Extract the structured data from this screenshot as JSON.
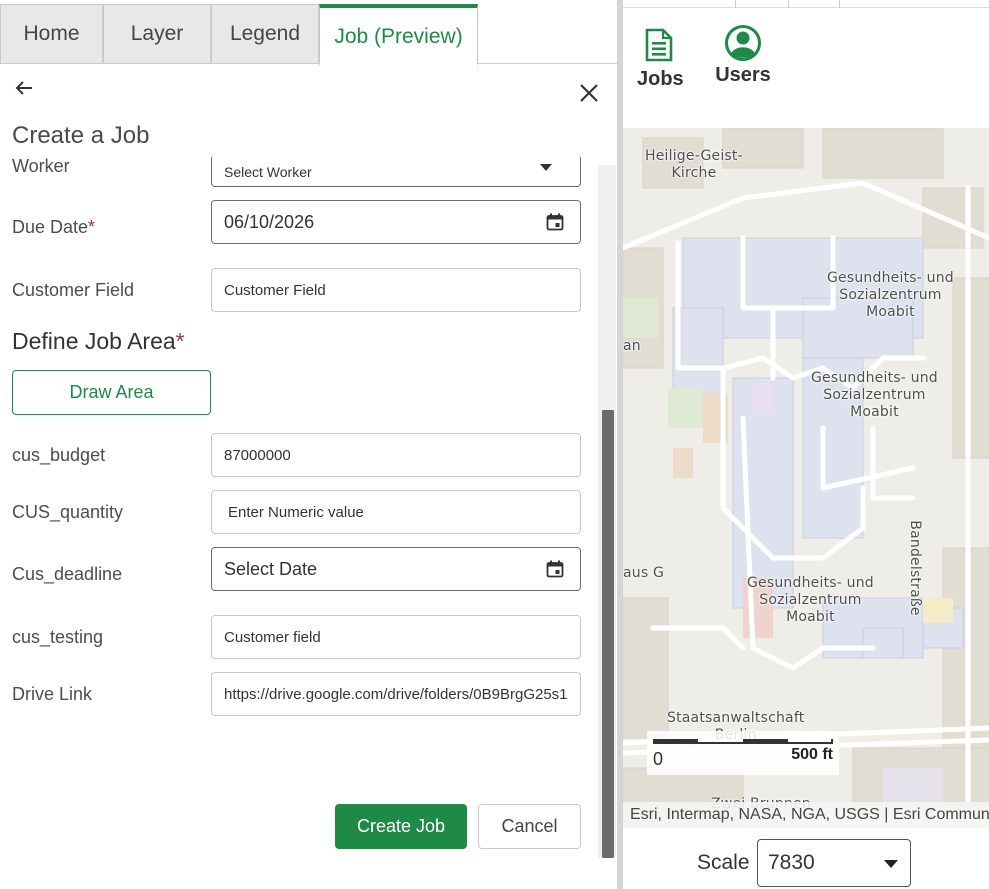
{
  "tabs": [
    "Home",
    "Layer",
    "Legend",
    "Job (Preview)"
  ],
  "panel": {
    "title": "Create a Job"
  },
  "form": {
    "worker": {
      "label": "Worker",
      "value": "Select Worker"
    },
    "due_date": {
      "label": "Due Date",
      "required": "*",
      "value": "06/10/2026"
    },
    "customer_field": {
      "label": "Customer Field",
      "placeholder": "Customer Field"
    },
    "job_area": {
      "title": "Define Job Area",
      "required": "*",
      "button": "Draw Area"
    },
    "cus_budget": {
      "label": "cus_budget",
      "value": "87000000"
    },
    "cus_quantity": {
      "label": "CUS_quantity",
      "placeholder": "Enter Numeric value"
    },
    "cus_deadline": {
      "label": "Cus_deadline",
      "placeholder": "Select Date"
    },
    "cus_testing": {
      "label": "cus_testing",
      "placeholder": "Customer field"
    },
    "drive_link": {
      "label": "Drive Link",
      "value": "https://drive.google.com/drive/folders/0B9BrgG25s1"
    }
  },
  "buttons": {
    "create": "Create Job",
    "cancel": "Cancel"
  },
  "widgets": {
    "jobs": "Jobs",
    "users": "Users"
  },
  "map": {
    "labels": {
      "heilige_geist_kirche": "Heilige-Geist-\nKirche",
      "gesundheits_1": "Gesundheits- und\nSozialzentrum\nMoabit",
      "gesundheits_2": "Gesundheits- und\nSozialzentrum\nMoabit",
      "gesundheits_3": "Gesundheits- und\nSozialzentrum\nMoabit",
      "an_fragment": "an",
      "haus_g": "aus G",
      "staatsanwaltschaft": "Staatsanwaltschaft\nBerlin",
      "bandelstrasse": "Bandelstraße",
      "zwei_brunnen": "Zwei Brunnen"
    },
    "scalebar": {
      "zero": "0",
      "end": "500 ft"
    },
    "attribution": "Esri, Intermap, NASA, NGA, USGS | Esri Community Maps Contributors"
  },
  "scale": {
    "label": "Scale",
    "value": "7830"
  },
  "colors": {
    "accent": "#1e8a46",
    "required": "#a8323e"
  }
}
